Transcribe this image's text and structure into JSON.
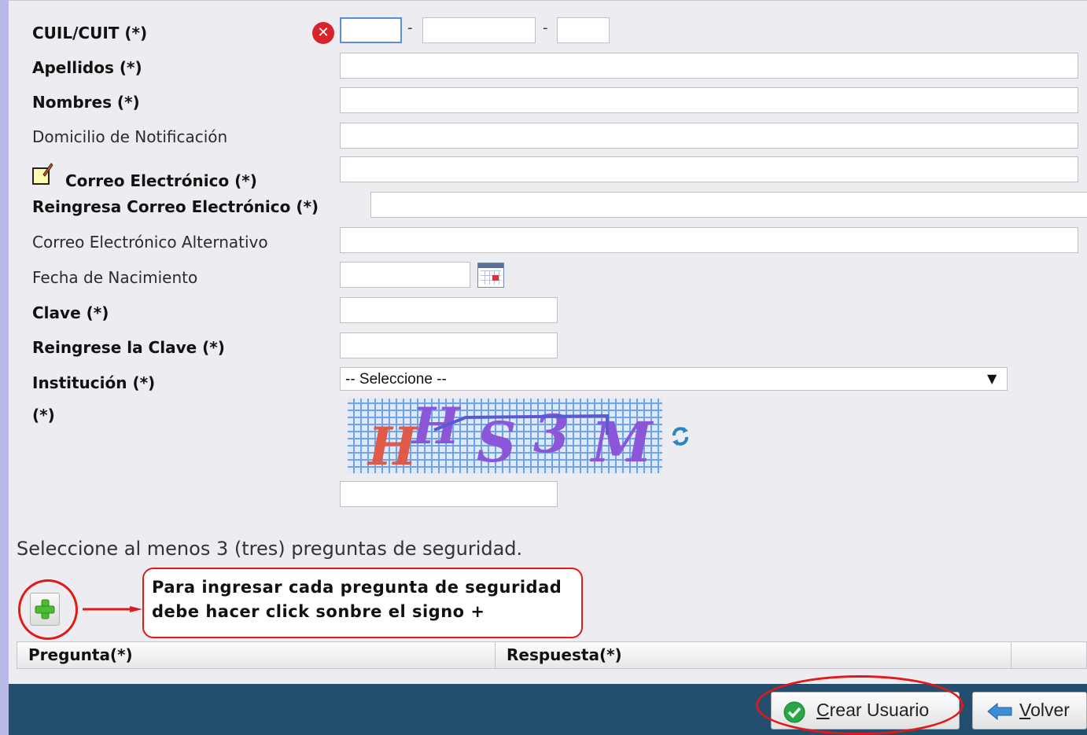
{
  "form": {
    "cuil": {
      "label": "CUIL/CUIT (*)",
      "sep1": "-",
      "sep2": "-",
      "error_icon": "error-x-icon"
    },
    "apellidos": {
      "label": "Apellidos (*)"
    },
    "nombres": {
      "label": "Nombres (*)"
    },
    "domicilio": {
      "label": "Domicilio de Notificación"
    },
    "correo": {
      "label": "Correo Electrónico (*)",
      "icon": "note-pencil-icon"
    },
    "reingresa_correo": {
      "label": "Reingresa Correo Electrónico (*)"
    },
    "correo_alt": {
      "label": "Correo Electrónico Alternativo"
    },
    "fecha": {
      "label": "Fecha de Nacimiento",
      "icon": "calendar-icon"
    },
    "clave": {
      "label": "Clave (*)"
    },
    "reingrese_clave": {
      "label": "Reingrese la Clave (*)"
    },
    "institucion": {
      "label": "Institución (*)",
      "selected": "-- Seleccione --"
    },
    "captcha": {
      "label": "(*)",
      "text": [
        "H",
        "H",
        "S",
        "3",
        "M"
      ],
      "refresh_icon": "refresh-icon"
    }
  },
  "security": {
    "instruction": "Seleccione al menos 3 (tres) preguntas de seguridad.",
    "add_icon": "plus-icon",
    "callout": [
      "Para ingresar cada pregunta de seguridad",
      "debe hacer click sonbre el signo +"
    ],
    "columns": [
      "Pregunta(*)",
      "Respuesta(*)"
    ]
  },
  "footer": {
    "create_label": "Crear Usuario",
    "create_icon": "check-circle-icon",
    "back_label": "Volver",
    "back_icon": "arrow-left-icon"
  },
  "colors": {
    "footer_bg": "#234e6e",
    "annotation_red": "#e01a1a",
    "error_red": "#d8232a"
  }
}
